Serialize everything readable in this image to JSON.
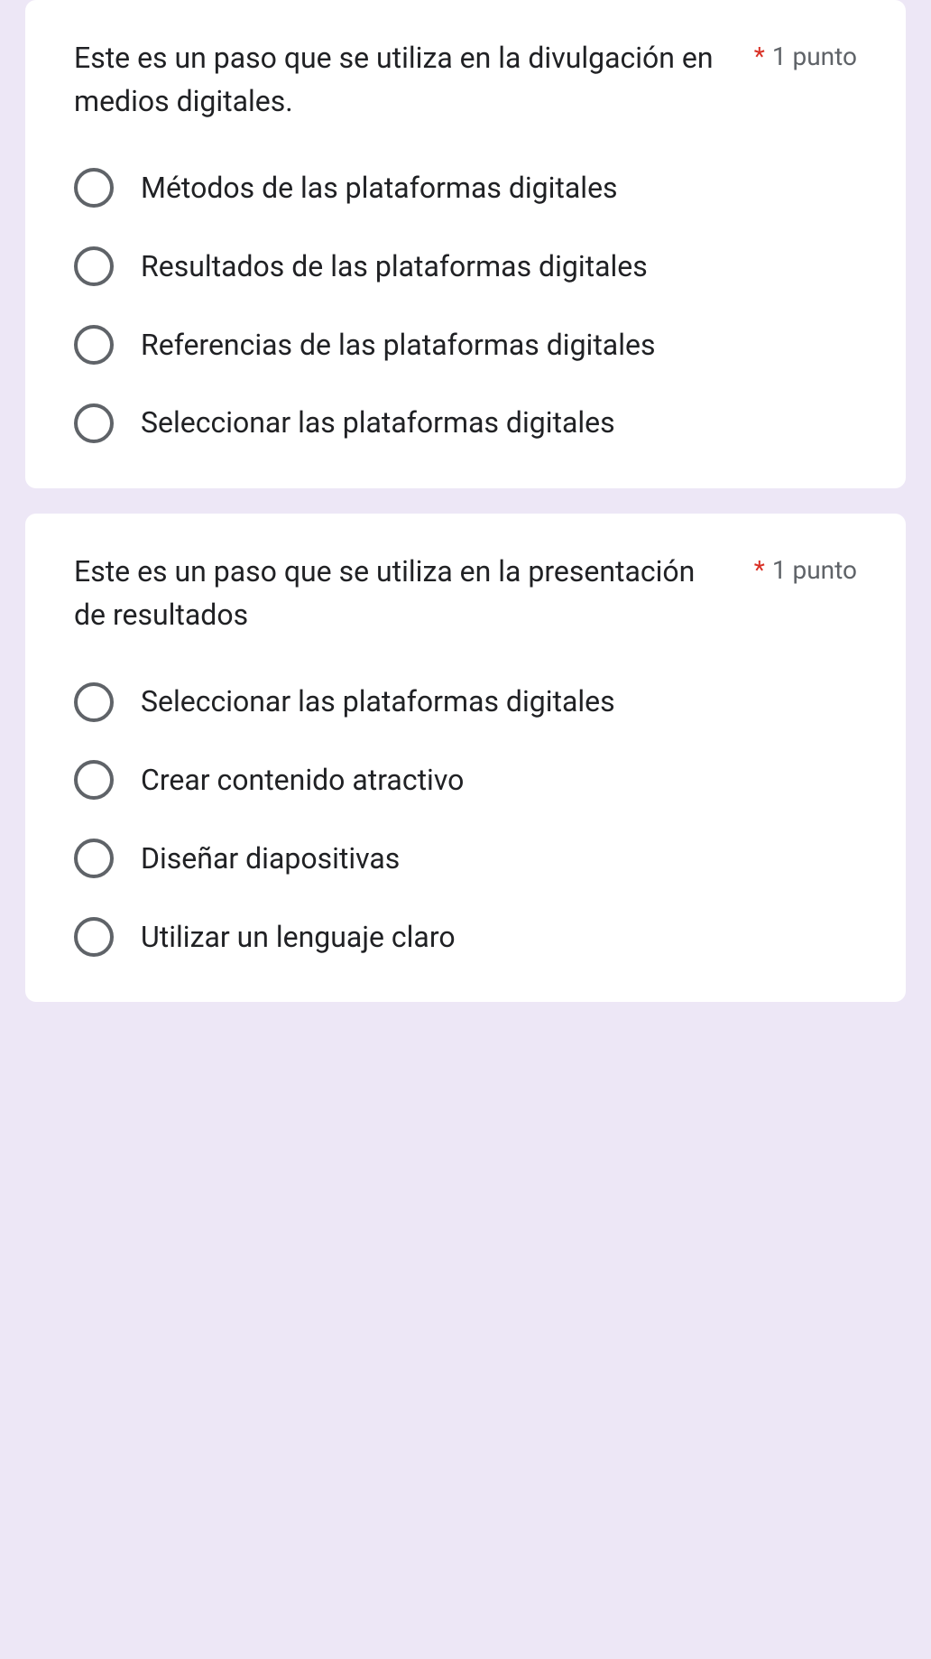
{
  "questions": [
    {
      "title": "Este es un paso que se utiliza en la divulgación en medios digitales.",
      "required_mark": "*",
      "points": "1 punto",
      "options": [
        "Métodos de las plataformas digitales",
        "Resultados de las plataformas digitales",
        "Referencias de las plataformas digitales",
        "Seleccionar  las plataformas digitales"
      ]
    },
    {
      "title": "Este es un paso que se utiliza en la presentación de resultados",
      "required_mark": "*",
      "points": "1 punto",
      "options": [
        "Seleccionar las plataformas digitales",
        "Crear contenido atractivo",
        "Diseñar diapositivas",
        "Utilizar un lenguaje claro"
      ]
    }
  ]
}
